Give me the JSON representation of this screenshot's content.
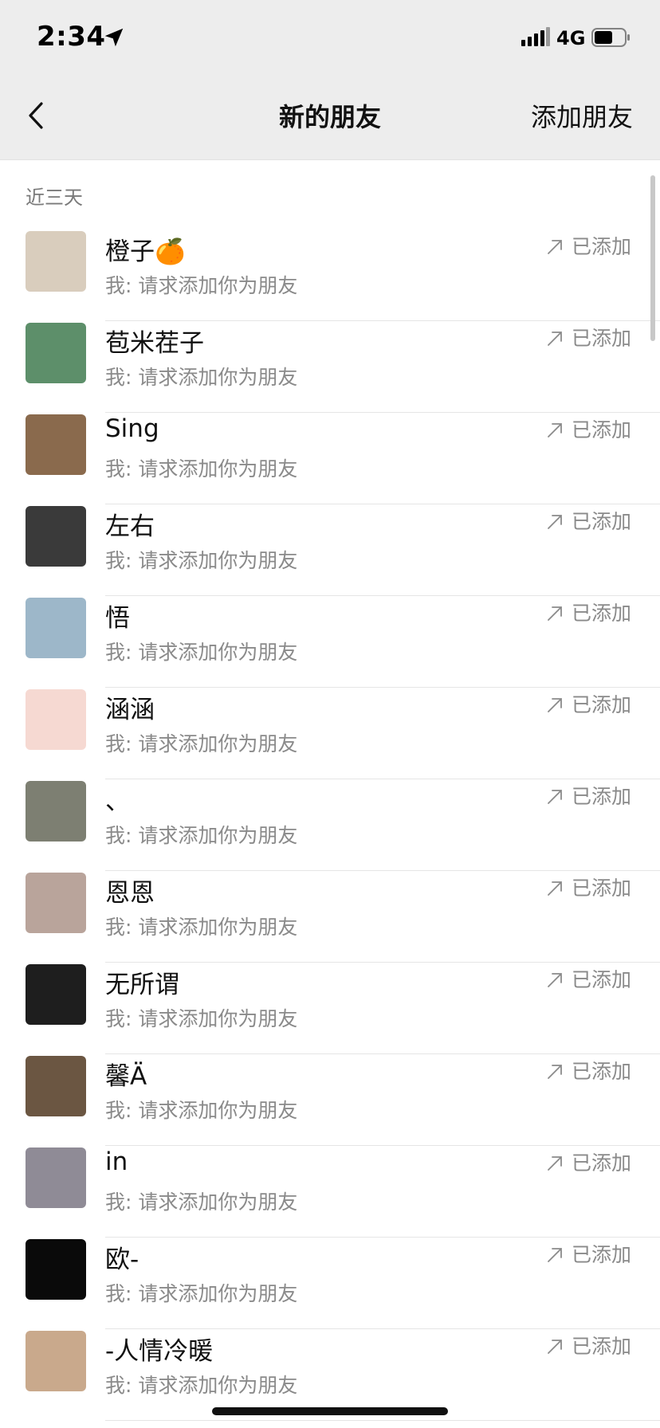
{
  "status_bar": {
    "time": "2:34",
    "network": "4G",
    "location_icon": "location-arrow-icon",
    "signal_icon": "signal-bars-icon",
    "battery_icon": "battery-icon"
  },
  "nav": {
    "back_icon": "chevron-left-icon",
    "title": "新的朋友",
    "action_label": "添加朋友"
  },
  "section": {
    "label": "近三天"
  },
  "contacts": [
    {
      "name": "橙子🍊",
      "message": "我: 请求添加你为朋友",
      "status": "已添加",
      "avatar_color": "#d9cdbd"
    },
    {
      "name": "苞米茬子",
      "message": "我: 请求添加你为朋友",
      "status": "已添加",
      "avatar_color": "#5d8f6a"
    },
    {
      "name": "Sing",
      "message": "我: 请求添加你为朋友",
      "status": "已添加",
      "avatar_color": "#8a6a4d"
    },
    {
      "name": "左右",
      "message": "我: 请求添加你为朋友",
      "status": "已添加",
      "avatar_color": "#3a3a3a"
    },
    {
      "name": "悟",
      "message": "我: 请求添加你为朋友",
      "status": "已添加",
      "avatar_color": "#9db7c9"
    },
    {
      "name": "涵涵",
      "message": "我: 请求添加你为朋友",
      "status": "已添加",
      "avatar_color": "#f6d9d2"
    },
    {
      "name": "、",
      "message": "我: 请求添加你为朋友",
      "status": "已添加",
      "avatar_color": "#7d7f72"
    },
    {
      "name": "恩恩",
      "message": "我: 请求添加你为朋友",
      "status": "已添加",
      "avatar_color": "#b9a49b"
    },
    {
      "name": "无所谓",
      "message": "我: 请求添加你为朋友",
      "status": "已添加",
      "avatar_color": "#1e1e1e"
    },
    {
      "name": "馨Ä",
      "message": "我: 请求添加你为朋友",
      "status": "已添加",
      "avatar_color": "#6b5642"
    },
    {
      "name": "in",
      "message": "我: 请求添加你为朋友",
      "status": "已添加",
      "avatar_color": "#8f8b96"
    },
    {
      "name": "欧-",
      "message": "我: 请求添加你为朋友",
      "status": "已添加",
      "avatar_color": "#0a0a0a"
    },
    {
      "name": "-人情冷暖",
      "message": "我: 请求添加你为朋友",
      "status": "已添加",
      "avatar_color": "#c9a98c"
    }
  ],
  "colors": {
    "header_bg": "#ededed",
    "secondary_text": "#8a8a8a",
    "divider": "#e5e5e5"
  }
}
